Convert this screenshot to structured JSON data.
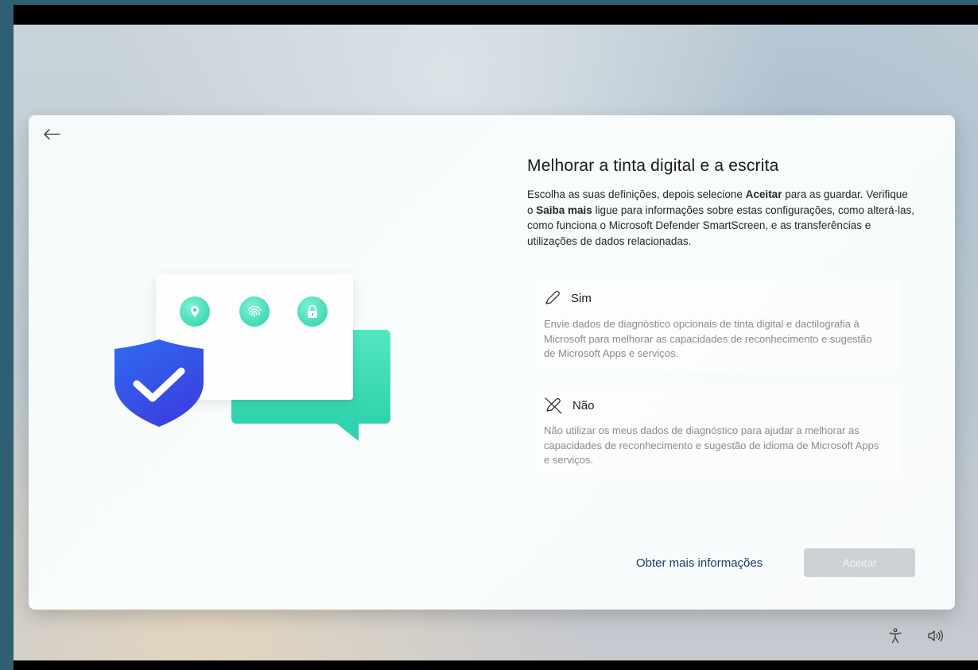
{
  "page": {
    "title": "Melhorar a tinta digital e a escrita",
    "description": {
      "part1": "Escolha as suas definições, depois selecione ",
      "bold1": "Aceitar",
      "part2": " para as guardar. Verifique o ",
      "bold2": "Saiba mais",
      "part3": " ligue para informações sobre estas configurações, como alterá-las, como funciona o Microsoft Defender SmartScreen, e as transferências e utilizações de dados relacionadas."
    }
  },
  "options": {
    "yes": {
      "label": "Sim",
      "icon": "pen-icon",
      "text": "Envie dados de diagnóstico opcionais de tinta digital e dactilografia à Microsoft para melhorar as capacidades de reconhecimento e sugestão de Microsoft Apps e serviços."
    },
    "no": {
      "label": "Não",
      "icon": "pen-off-icon",
      "text": "Não utilizar os meus dados de diagnóstico para ajudar a melhorar as capacidades de reconhecimento e sugestão de idioma de Microsoft Apps e serviços."
    }
  },
  "footer": {
    "more_info_label": "Obter mais informações",
    "accept_label": "Aceitar"
  },
  "tray": {
    "accessibility_icon": "accessibility-icon",
    "volume_icon": "volume-icon"
  },
  "colors": {
    "accent_teal": "#2fd3ad",
    "shield_blue": "#2f5cf0",
    "link": "#1a3a6c",
    "accept_disabled": "#cdd1d4"
  }
}
